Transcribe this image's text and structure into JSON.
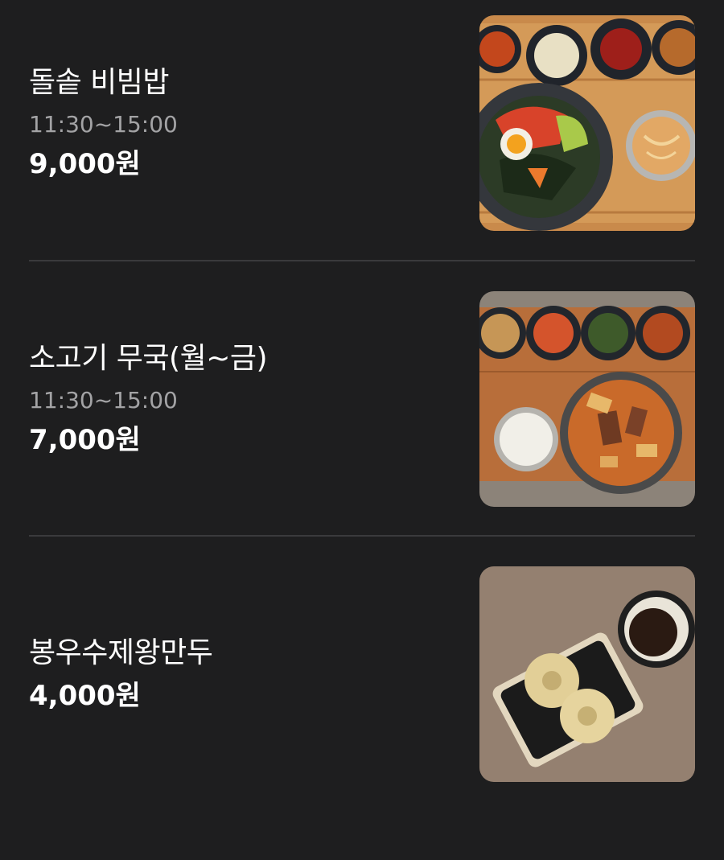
{
  "menu": {
    "items": [
      {
        "name": "돌솥 비빔밥",
        "hours": "11:30~15:00",
        "price": "9,000원",
        "photo_icon": "bibimbap-photo"
      },
      {
        "name": "소고기 무국(월~금)",
        "hours": "11:30~15:00",
        "price": "7,000원",
        "photo_icon": "beef-radish-soup-photo"
      },
      {
        "name": "봉우수제왕만두",
        "price": "4,000원",
        "photo_icon": "dumplings-photo"
      }
    ]
  },
  "colors": {
    "background": "#1e1e1f",
    "text_primary": "#ffffff",
    "text_secondary": "#a3a3a5",
    "divider": "#3a3a3c"
  }
}
